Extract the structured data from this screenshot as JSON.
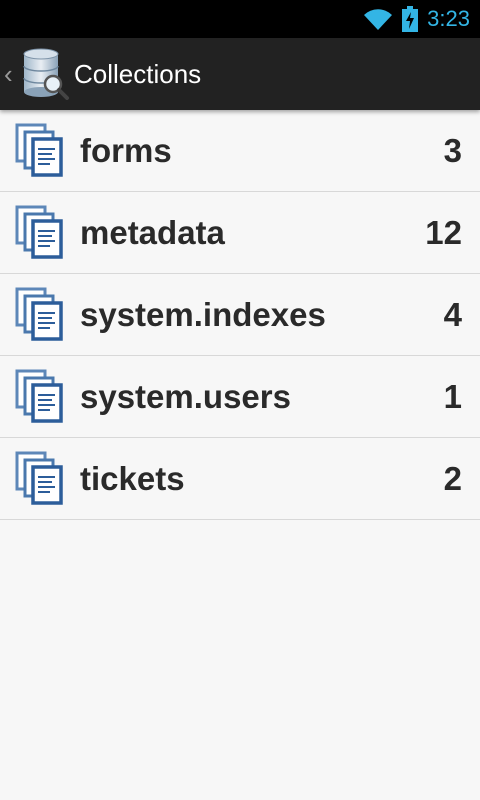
{
  "status_bar": {
    "time": "3:23",
    "wifi_icon": "wifi-icon",
    "battery_icon": "battery-charging-icon"
  },
  "action_bar": {
    "up_icon": "chevron-left-icon",
    "app_icon": "database-search-icon",
    "title": "Collections"
  },
  "collections": [
    {
      "name": "forms",
      "count": "3"
    },
    {
      "name": "metadata",
      "count": "12"
    },
    {
      "name": "system.indexes",
      "count": "4"
    },
    {
      "name": "system.users",
      "count": "1"
    },
    {
      "name": "tickets",
      "count": "2"
    }
  ],
  "colors": {
    "status_accent": "#33b5e5",
    "action_bar": "#222222",
    "background": "#f7f7f7",
    "icon_blue": "#2c5d9a"
  }
}
